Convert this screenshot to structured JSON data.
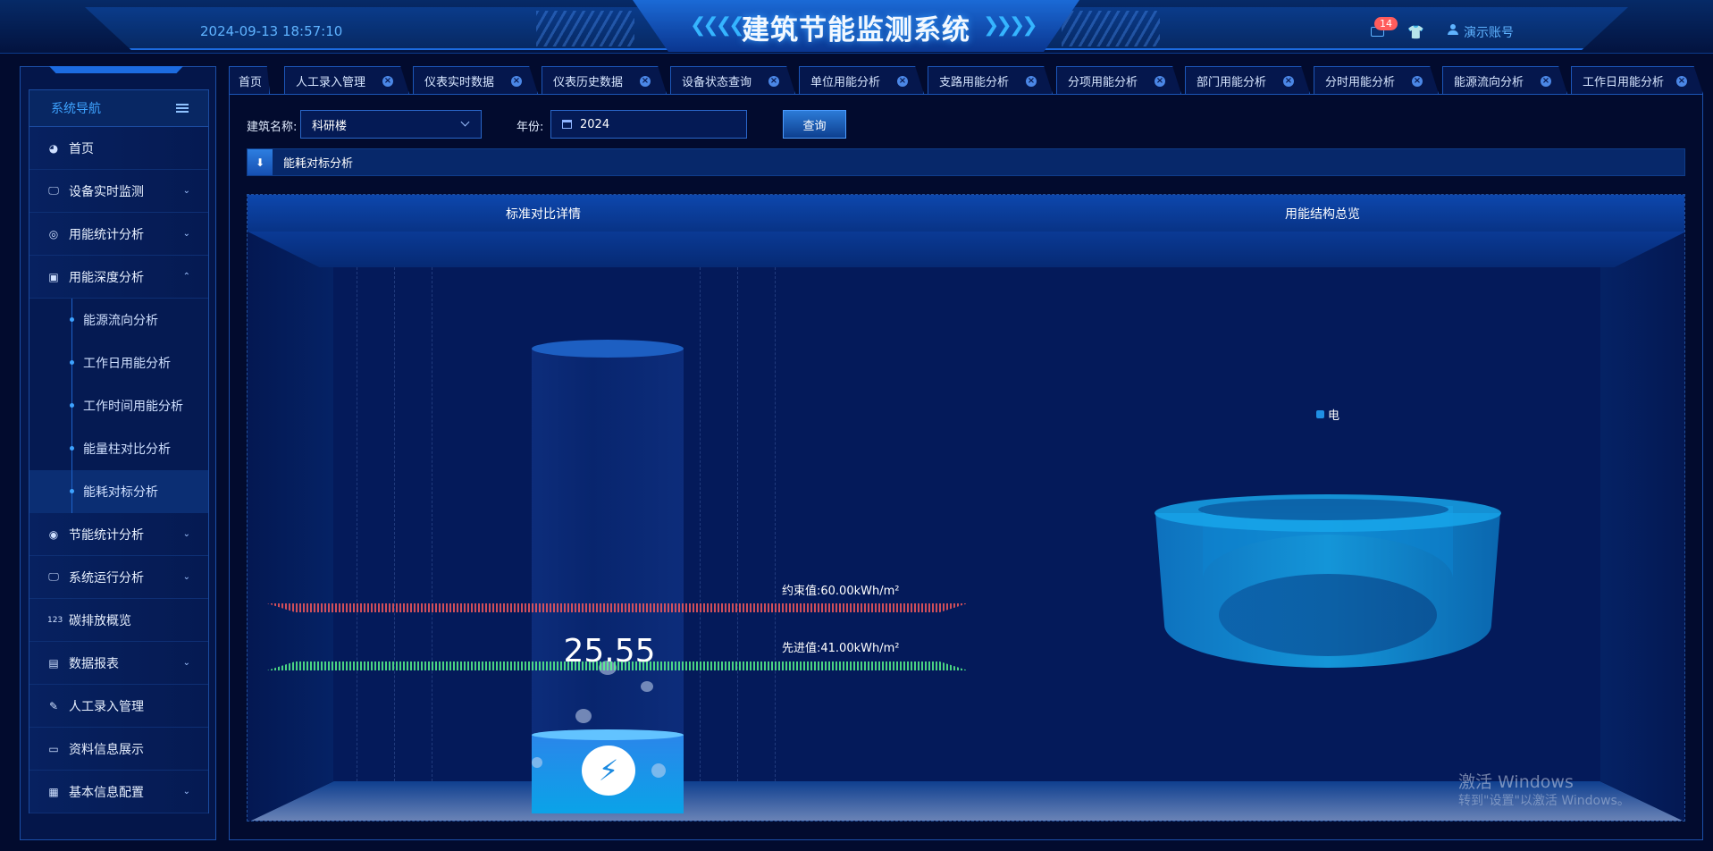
{
  "header": {
    "title": "建筑节能监测系统",
    "datetime": "2024-09-13 18:57:10",
    "notifications_count": "14",
    "user": "演示账号"
  },
  "sidebar": {
    "title": "系统导航",
    "items": [
      {
        "label": "首页",
        "icon": "dashboard-icon"
      },
      {
        "label": "设备实时监测",
        "icon": "monitor-icon",
        "caret": "down"
      },
      {
        "label": "用能统计分析",
        "icon": "lifebuoy-icon",
        "caret": "down"
      },
      {
        "label": "用能深度分析",
        "icon": "image-icon",
        "caret": "up"
      },
      {
        "label": "节能统计分析",
        "icon": "globe-icon",
        "caret": "down"
      },
      {
        "label": "系统运行分析",
        "icon": "monitor-icon",
        "caret": "down"
      },
      {
        "label": "碳排放概览",
        "icon": "number-icon"
      },
      {
        "label": "数据报表",
        "icon": "file-icon",
        "caret": "down"
      },
      {
        "label": "人工录入管理",
        "icon": "edit-icon"
      },
      {
        "label": "资料信息展示",
        "icon": "card-icon"
      },
      {
        "label": "基本信息配置",
        "icon": "save-icon",
        "caret": "down"
      }
    ],
    "subitems": [
      "能源流向分析",
      "工作日用能分析",
      "工作时间用能分析",
      "能量柱对比分析",
      "能耗对标分析"
    ],
    "active_subitem": "能耗对标分析"
  },
  "tabs": [
    "首页",
    "人工录入管理",
    "仪表实时数据",
    "仪表历史数据",
    "设备状态查询",
    "单位用能分析",
    "支路用能分析",
    "分项用能分析",
    "部门用能分析",
    "分时用能分析",
    "能源流向分析",
    "工作日用能分析"
  ],
  "filters": {
    "building_label": "建筑名称:",
    "building_value": "科研楼",
    "year_label": "年份:",
    "year_value": "2024",
    "query_button": "查询"
  },
  "section": {
    "title": "能耗对标分析"
  },
  "panels": {
    "left_title": "标准对比详情",
    "right_title": "用能结构总览"
  },
  "benchmark": {
    "current_value": "25.55",
    "constraint_label": "约束值:60.00kWh/m²",
    "advanced_label": "先进值:41.00kWh/m²",
    "constraint_value": 60.0,
    "advanced_value": 41.0,
    "unit": "kWh/m²",
    "colors": {
      "constraint": "#ff5a5a",
      "advanced": "#5aff8c",
      "liquid": "#0aa3e8"
    }
  },
  "structure": {
    "legend": "电",
    "legend_color": "#1f8fe3"
  },
  "watermark": {
    "line1": "激活 Windows",
    "line2": "转到\"设置\"以激活 Windows。"
  }
}
